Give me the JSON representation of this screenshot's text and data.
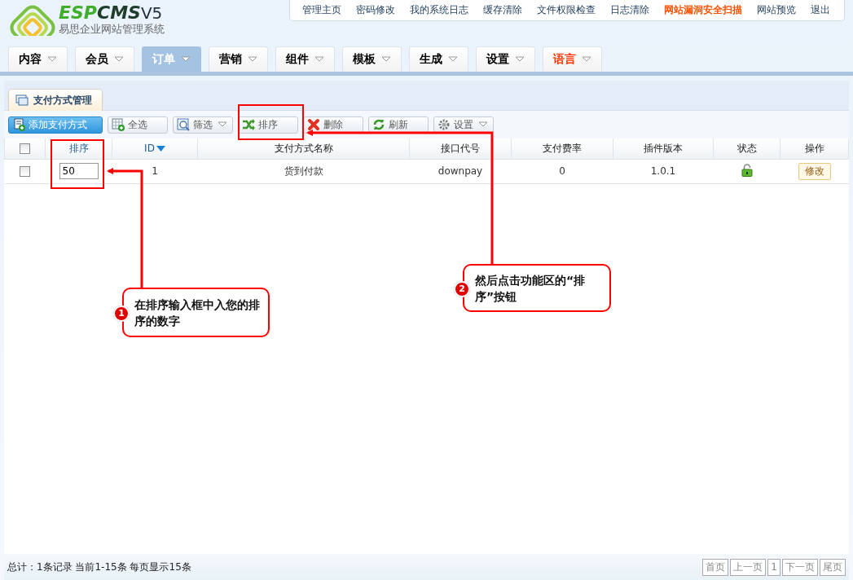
{
  "logo": {
    "wordmark_prefix": "ESP",
    "wordmark": "CMS",
    "version": "V5",
    "subtitle": "易思企业网站管理系统"
  },
  "top_links": [
    {
      "label": "管理主页",
      "highlight": false
    },
    {
      "label": "密码修改",
      "highlight": false
    },
    {
      "label": "我的系统日志",
      "highlight": false
    },
    {
      "label": "缓存清除",
      "highlight": false
    },
    {
      "label": "文件权限检查",
      "highlight": false
    },
    {
      "label": "日志清除",
      "highlight": false
    },
    {
      "label": "网站漏洞安全扫描",
      "highlight": true
    },
    {
      "label": "网站预览",
      "highlight": false
    },
    {
      "label": "退出",
      "highlight": false
    }
  ],
  "nav_tabs": [
    {
      "label": "内容",
      "selected": false,
      "color": "#000000"
    },
    {
      "label": "会员",
      "selected": false,
      "color": "#000000"
    },
    {
      "label": "订单",
      "selected": true,
      "color": "#ffffff"
    },
    {
      "label": "营销",
      "selected": false,
      "color": "#000000"
    },
    {
      "label": "组件",
      "selected": false,
      "color": "#000000"
    },
    {
      "label": "模板",
      "selected": false,
      "color": "#000000"
    },
    {
      "label": "生成",
      "selected": false,
      "color": "#000000"
    },
    {
      "label": "设置",
      "selected": false,
      "color": "#000000"
    },
    {
      "label": "语言",
      "selected": false,
      "color": "#ff3300"
    }
  ],
  "panel": {
    "title": "支付方式管理"
  },
  "toolbar": [
    {
      "label": "添加支付方式",
      "kind": "primary",
      "dropdown": false
    },
    {
      "label": "全选",
      "kind": "normal",
      "dropdown": false
    },
    {
      "label": "筛选",
      "kind": "normal",
      "dropdown": true
    },
    {
      "label": "排序",
      "kind": "normal",
      "dropdown": false
    },
    {
      "label": "删除",
      "kind": "normal",
      "dropdown": false
    },
    {
      "label": "刷新",
      "kind": "normal",
      "dropdown": false
    },
    {
      "label": "设置",
      "kind": "normal",
      "dropdown": true
    }
  ],
  "table": {
    "columns": [
      {
        "label": "排序",
        "sorted": false,
        "link": true
      },
      {
        "label": "ID",
        "sorted": true,
        "link": true
      },
      {
        "label": "支付方式名称",
        "sorted": false,
        "link": false
      },
      {
        "label": "接口代号",
        "sorted": false,
        "link": false
      },
      {
        "label": "支付费率",
        "sorted": false,
        "link": false
      },
      {
        "label": "插件版本",
        "sorted": false,
        "link": false
      },
      {
        "label": "状态",
        "sorted": false,
        "link": false
      },
      {
        "label": "操作",
        "sorted": false,
        "link": false
      }
    ],
    "header_checked": false,
    "rows": [
      {
        "checked": false,
        "order": "50",
        "id": "1",
        "name": "货到付款",
        "code": "downpay",
        "rate": "0",
        "version": "1.0.1",
        "locked": false,
        "action": "修改"
      }
    ]
  },
  "callouts": [
    {
      "number": "1",
      "text": "在排序输入框中入您的排序的数字"
    },
    {
      "number": "2",
      "text": "然后点击功能区的“排序”按钮"
    }
  ],
  "status_bar": {
    "summary": "总计：1条记录 当前1-15条 每页显示15条",
    "pager": [
      "首页",
      "上一页",
      "1",
      "下一页",
      "尾页"
    ]
  }
}
